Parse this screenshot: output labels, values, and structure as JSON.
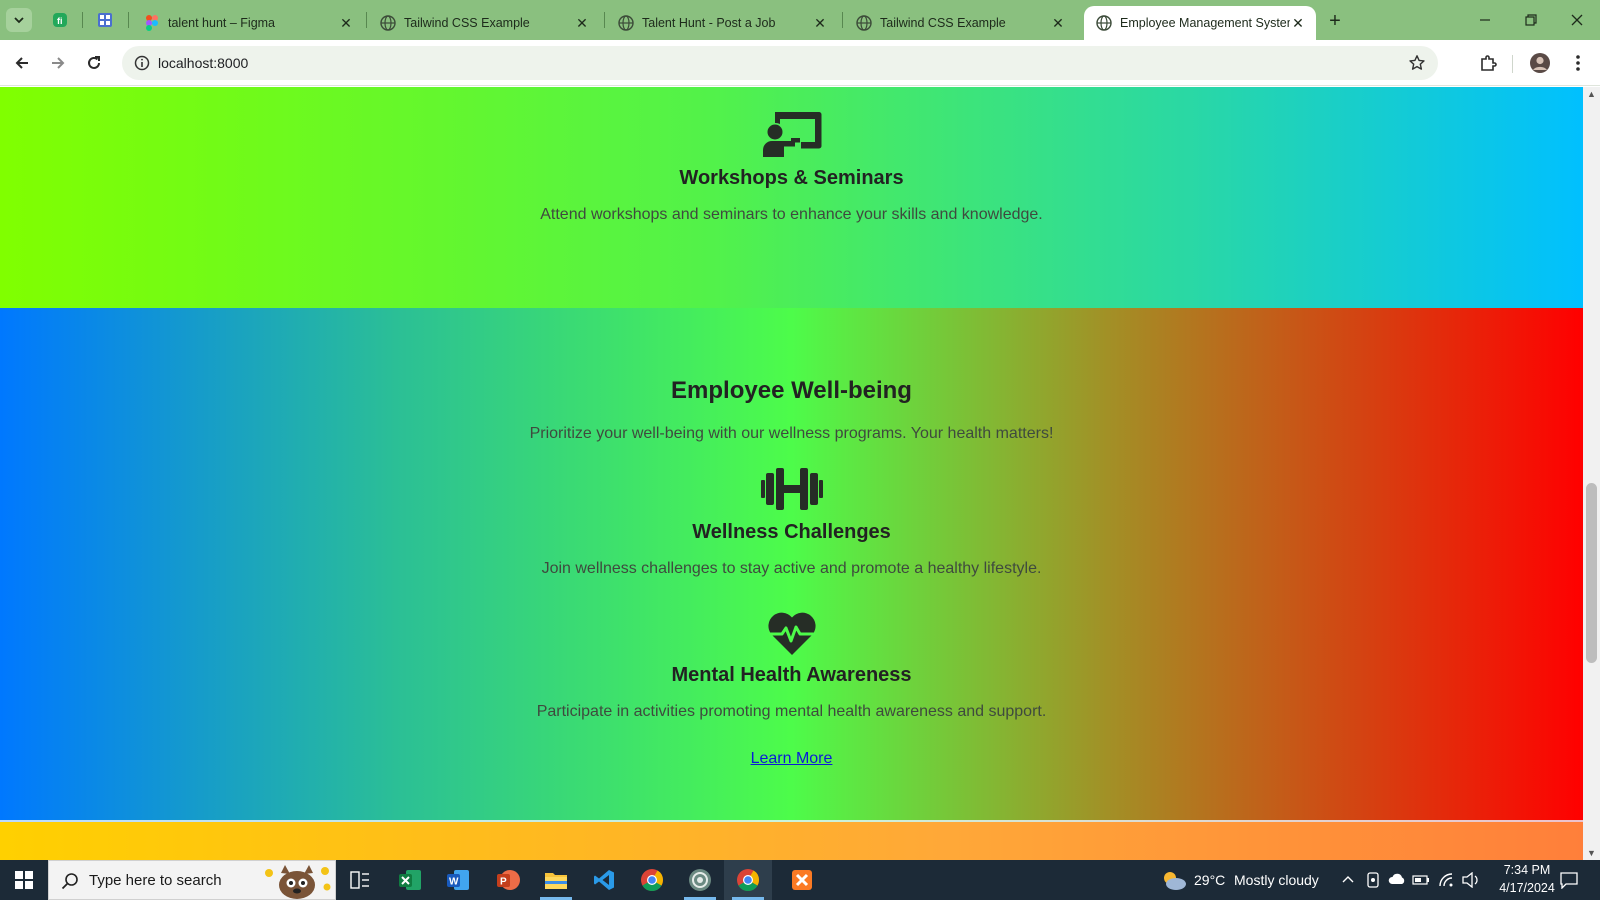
{
  "browser": {
    "tabs": [
      {
        "title": "talent hunt – Figma",
        "active": false
      },
      {
        "title": "Tailwind CSS Example",
        "active": false
      },
      {
        "title": "Talent Hunt - Post a Job",
        "active": false
      },
      {
        "title": "Tailwind CSS Example",
        "active": false
      },
      {
        "title": "Employee Management System",
        "active": true
      }
    ],
    "url": "localhost:8000"
  },
  "page": {
    "workshops": {
      "icon": "chalkboard-teacher-icon",
      "title": "Workshops & Seminars",
      "description": "Attend workshops and seminars to enhance your skills and knowledge."
    },
    "wellbeing": {
      "title": "Employee Well-being",
      "subtitle": "Prioritize your well-being with our wellness programs. Your health matters!",
      "items": [
        {
          "icon": "dumbbell-icon",
          "title": "Wellness Challenges",
          "description": "Join wellness challenges to stay active and promote a healthy lifestyle."
        },
        {
          "icon": "heart-pulse-icon",
          "title": "Mental Health Awareness",
          "description": "Participate in activities promoting mental health awareness and support."
        }
      ],
      "link": "Learn More"
    }
  },
  "taskbar": {
    "search_placeholder": "Type here to search",
    "weather": {
      "temp": "29°C",
      "condition": "Mostly cloudy"
    },
    "time": "7:34 PM",
    "date": "4/17/2024"
  },
  "colors": {
    "tabstrip": "#8ac07f",
    "section1_gradient": [
      "#80ff00",
      "#00c0ff"
    ],
    "section2_gradient": [
      "#0078ff",
      "#4dfc4a",
      "#ff0000"
    ],
    "section3_gradient": [
      "#ffd000",
      "#ff7f3a"
    ],
    "link": "#0b1ad8"
  }
}
